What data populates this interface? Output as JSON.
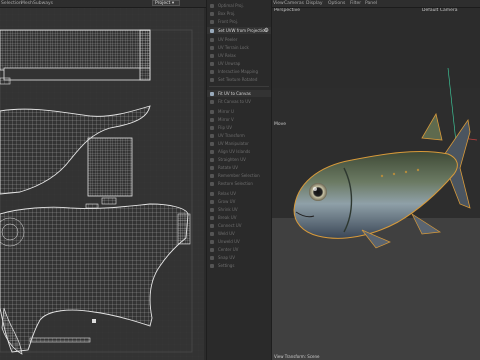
{
  "topbar": {
    "menu_left": [
      "Selection",
      "Mesh",
      "Subways"
    ],
    "uv_mode": "Project",
    "view_menu": [
      "View",
      "Cameras",
      "Display",
      "Options",
      "Filter",
      "Panel"
    ],
    "camera_label": "Default Camera",
    "perspective_label": "Perspective"
  },
  "panel": {
    "items": [
      {
        "label": "Optimal Proj.",
        "active": false
      },
      {
        "label": "Box Proj.",
        "active": false
      },
      {
        "label": "Front Proj.",
        "active": false
      },
      {
        "label": "Set UVW from Projection",
        "active": true,
        "gear": true
      },
      {
        "label": "UV Peeler",
        "active": false
      },
      {
        "label": "UV Terrain Lock",
        "active": false
      },
      {
        "label": "UV Relax",
        "active": false
      },
      {
        "label": "UV Unwrap",
        "active": false
      },
      {
        "label": "Interactive Mapping",
        "active": false
      },
      {
        "label": "Set Texture Rotated",
        "active": false
      },
      {
        "label": "Fit UV to Canvas",
        "active": true
      },
      {
        "label": "Fit Canvas to UV",
        "active": false
      },
      {
        "label": "Mirror U",
        "active": false
      },
      {
        "label": "Mirror V",
        "active": false
      },
      {
        "label": "Flip UV",
        "active": false
      },
      {
        "label": "UV Transform",
        "active": false
      },
      {
        "label": "UV Manipulator",
        "active": false
      },
      {
        "label": "Align UV Islands",
        "active": false
      },
      {
        "label": "Straighten UV",
        "active": false
      },
      {
        "label": "Rotate UV",
        "active": false
      },
      {
        "label": "Remember Selection",
        "active": false
      },
      {
        "label": "Restore Selection",
        "active": false
      },
      {
        "label": "Relax UV",
        "active": false
      },
      {
        "label": "Grow UV",
        "active": false
      },
      {
        "label": "Shrink UV",
        "active": false
      },
      {
        "label": "Break UV",
        "active": false
      },
      {
        "label": "Connect UV",
        "active": false
      },
      {
        "label": "Weld UV",
        "active": false
      },
      {
        "label": "Unweld UV",
        "active": false
      },
      {
        "label": "Center UV",
        "active": false
      },
      {
        "label": "Snap UV",
        "active": false
      },
      {
        "label": "Settings",
        "active": false
      }
    ]
  },
  "viewport": {
    "move_label": "Move",
    "status_text": "View Transform: Scene"
  },
  "colors": {
    "accent": "#d89a3a",
    "uv_lines": "#d9d9d9"
  }
}
